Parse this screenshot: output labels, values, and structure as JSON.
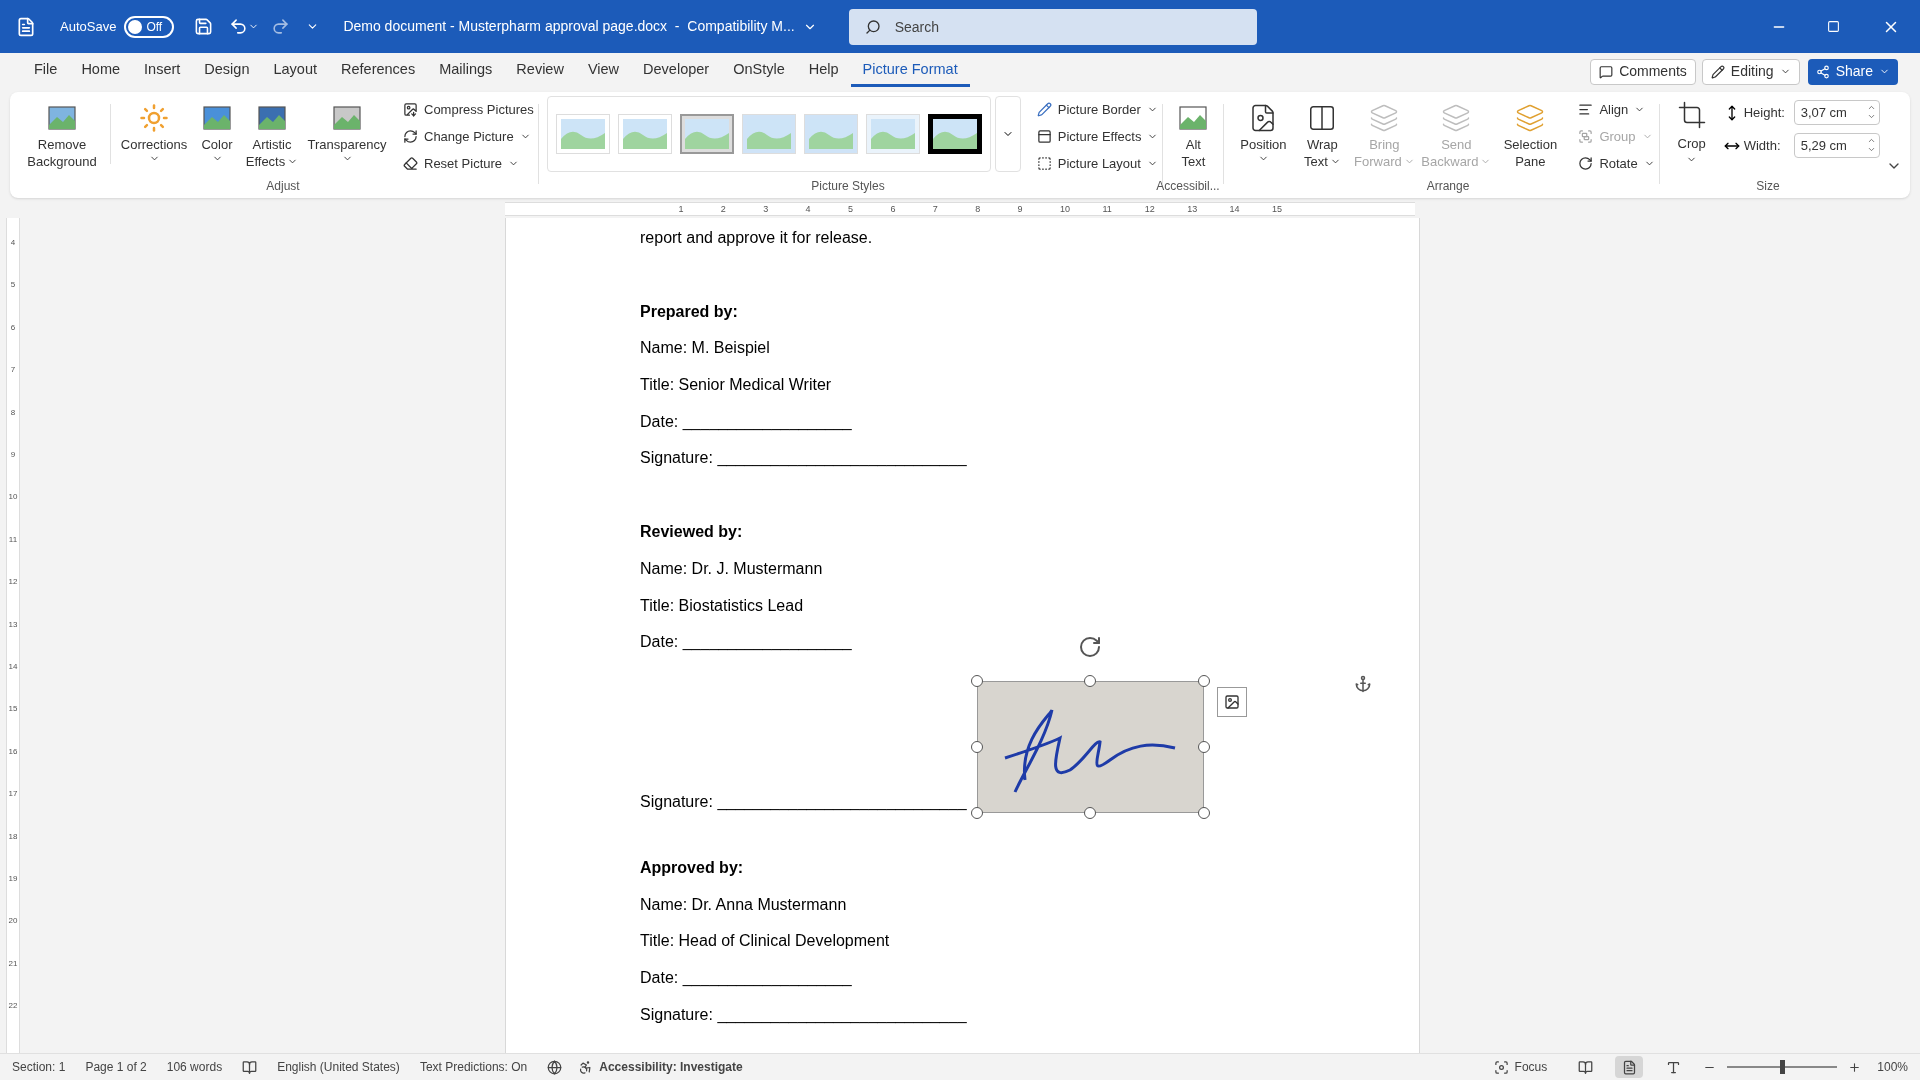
{
  "title_bar": {
    "autosave_label": "AutoSave",
    "autosave_toggle": {
      "label": "Off",
      "on": false
    },
    "document_title": "Demo document - Musterpharm approval page.docx  -  Compatibility M...",
    "search": {
      "placeholder": "Search"
    }
  },
  "menu_tabs": [
    {
      "label": "File",
      "selected": false
    },
    {
      "label": "Home",
      "selected": false
    },
    {
      "label": "Insert",
      "selected": false
    },
    {
      "label": "Design",
      "selected": false
    },
    {
      "label": "Layout",
      "selected": false
    },
    {
      "label": "References",
      "selected": false
    },
    {
      "label": "Mailings",
      "selected": false
    },
    {
      "label": "Review",
      "selected": false
    },
    {
      "label": "View",
      "selected": false
    },
    {
      "label": "Developer",
      "selected": false
    },
    {
      "label": "OnStyle",
      "selected": false
    },
    {
      "label": "Help",
      "selected": false
    },
    {
      "label": "Picture Format",
      "selected": true
    }
  ],
  "top_right_buttons": [
    "Comments",
    "Editing",
    "Share"
  ],
  "ribbon": {
    "adjust": {
      "label": "Adjust",
      "large_buttons": [
        {
          "lines": [
            "Remove",
            "Background"
          ],
          "dropdown": false
        },
        {
          "lines": [
            "Corrections"
          ],
          "dropdown": true
        },
        {
          "lines": [
            "Color"
          ],
          "dropdown": true
        },
        {
          "lines": [
            "Artistic",
            "Effects"
          ],
          "dropdown": true
        },
        {
          "lines": [
            "Transparency"
          ],
          "dropdown": true
        }
      ],
      "small_buttons": [
        {
          "label": "Compress Pictures",
          "dropdown": false
        },
        {
          "label": "Change Picture",
          "dropdown": true
        },
        {
          "label": "Reset Picture",
          "dropdown": true
        }
      ]
    },
    "picture_styles": {
      "label": "Picture Styles",
      "small_buttons": [
        {
          "label": "Picture Border",
          "dropdown": true
        },
        {
          "label": "Picture Effects",
          "dropdown": true
        },
        {
          "label": "Picture Layout",
          "dropdown": true
        }
      ]
    },
    "accessibility": {
      "label": "Accessibil...",
      "large_buttons": [
        {
          "lines": [
            "Alt",
            "Text"
          ],
          "dropdown": false
        }
      ]
    },
    "arrange": {
      "label": "Arrange",
      "large_buttons": [
        {
          "lines": [
            "Position"
          ],
          "dropdown": true,
          "disabled": false
        },
        {
          "lines": [
            "Wrap",
            "Text"
          ],
          "dropdown": true,
          "disabled": false
        },
        {
          "lines": [
            "Bring",
            "Forward"
          ],
          "dropdown": true,
          "disabled": true
        },
        {
          "lines": [
            "Send",
            "Backward"
          ],
          "dropdown": true,
          "disabled": true
        },
        {
          "lines": [
            "Selection",
            "Pane"
          ],
          "dropdown": false,
          "disabled": false
        }
      ],
      "small_buttons": [
        {
          "label": "Align",
          "dropdown": true,
          "disabled": false
        },
        {
          "label": "Group",
          "dropdown": true,
          "disabled": true
        },
        {
          "label": "Rotate",
          "dropdown": true,
          "disabled": false
        }
      ]
    },
    "size": {
      "label": "Size",
      "crop": {
        "lines": [
          "Crop"
        ],
        "dropdown": true
      },
      "height": {
        "label": "Height:",
        "value": "3,07 cm"
      },
      "width": {
        "label": "Width:",
        "value": "5,29 cm"
      }
    }
  },
  "horizontal_ruler": [
    "1",
    "2",
    "3",
    "4",
    "5",
    "6",
    "7",
    "8",
    "9",
    "10",
    "11",
    "12",
    "13",
    "14",
    "15"
  ],
  "vertical_ruler": [
    "4",
    "5",
    "6",
    "7",
    "8",
    "9",
    "10",
    "11",
    "12",
    "13",
    "14",
    "15",
    "16",
    "17",
    "18",
    "19",
    "20",
    "21",
    "22"
  ],
  "document": {
    "paragraphs": [
      {
        "kind": "text",
        "text": "report and approve it for release."
      },
      {
        "kind": "heading",
        "text": "Prepared by:"
      },
      {
        "kind": "text",
        "text": "Name: M. Beispiel"
      },
      {
        "kind": "text",
        "text": "Title: Senior Medical Writer"
      },
      {
        "kind": "text",
        "text": "Date: ___________________"
      },
      {
        "kind": "text",
        "text": "Signature: ____________________________"
      },
      {
        "kind": "heading",
        "text": "Reviewed by:"
      },
      {
        "kind": "text",
        "text": "Name: Dr. J. Mustermann"
      },
      {
        "kind": "text",
        "text": "Title: Biostatistics Lead"
      },
      {
        "kind": "text",
        "text": "Date: ___________________"
      },
      {
        "kind": "signed",
        "text": "Signature: ____________________________"
      },
      {
        "kind": "heading",
        "text": "Approved by:"
      },
      {
        "kind": "text",
        "text": "Name: Dr. Anna Mustermann"
      },
      {
        "kind": "text",
        "text": "Title: Head of Clinical Development"
      },
      {
        "kind": "text",
        "text": "Date: ___________________"
      },
      {
        "kind": "text",
        "text": "Signature: ____________________________"
      }
    ]
  },
  "status_bar": {
    "left": [
      "Section: 1",
      "Page 1 of 2",
      "106 words"
    ],
    "language": "English (United States)",
    "predictions": "Text Predictions: On",
    "accessibility": "Accessibility: Investigate",
    "focus": "Focus",
    "views": [
      {
        "selected": false
      },
      {
        "selected": true
      },
      {
        "selected": false
      }
    ],
    "zoom": {
      "level": 0.5
    },
    "zoom_label": "100%"
  }
}
